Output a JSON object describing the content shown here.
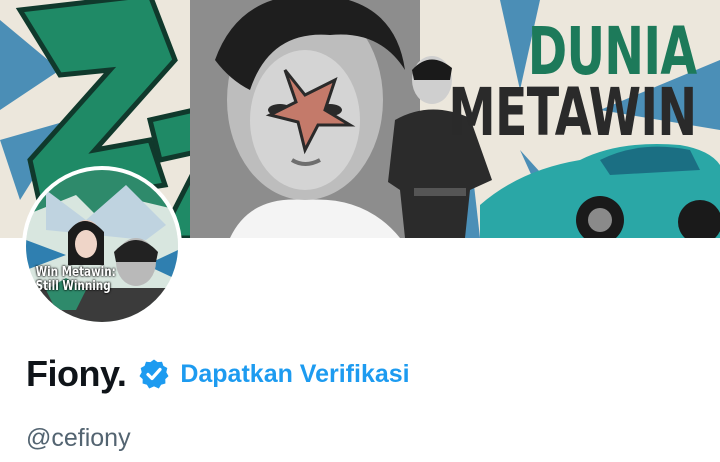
{
  "banner": {
    "title_line1": "DUNIA",
    "title_line2": "METAWIN",
    "accent_color": "#1d7a5a"
  },
  "avatar": {
    "line1": "Win Metawin:",
    "line2": "Still Winning"
  },
  "profile": {
    "display_name": "Fiony.",
    "verify_label": "Dapatkan Verifikasi",
    "handle": "@cefiony",
    "verify_color": "#1d9bf0",
    "icons": [
      "verified-badge-icon"
    ]
  }
}
